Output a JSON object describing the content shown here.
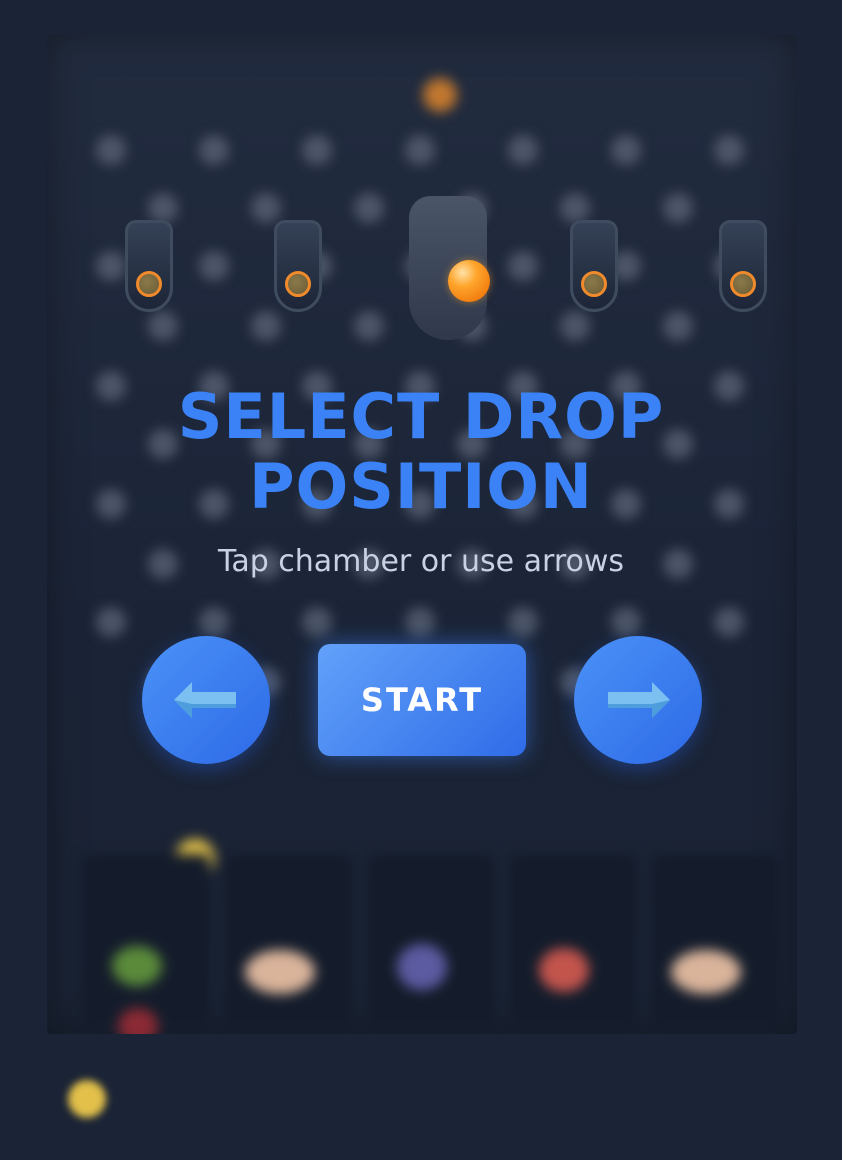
{
  "overlay": {
    "title_line1": "SELECT DROP",
    "title_line2": "POSITION",
    "subtitle": "Tap chamber or use arrows",
    "start_label": "START"
  },
  "chambers": {
    "count": 5,
    "selected_index": 2
  },
  "colors": {
    "accent": "#3b82f6",
    "ball": "#f59e0b",
    "coin": "#e3c24a"
  },
  "icons": {
    "left": "arrow-left-icon",
    "right": "arrow-right-icon"
  }
}
